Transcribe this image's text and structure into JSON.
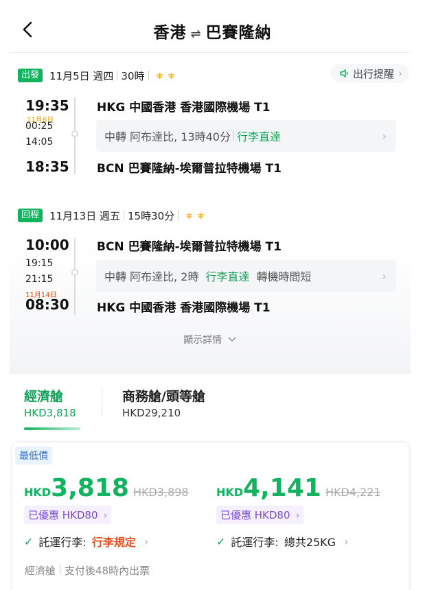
{
  "header": {
    "origin": "香港",
    "destination": "巴賽隆納",
    "swap_glyph": "⇌"
  },
  "outbound": {
    "tag": "出發",
    "date": "11月5日 週四",
    "duration": "30時",
    "reminder_label": "出行提醒",
    "depart_time": "19:35",
    "transfer_arrive_note": "11月6日",
    "transfer_arrive_time": "00:25",
    "transfer_depart_time": "14:05",
    "arrive_time": "18:35",
    "depart_airport": "HKG 中國香港 香港國際機場 T1",
    "transfer_text": "中轉 阿布達比, 13時40分",
    "transfer_baggage": "行李直達",
    "arrive_airport": "BCN 巴賽隆納-埃爾普拉特機場 T1"
  },
  "return": {
    "tag": "回程",
    "date": "11月13日 週五",
    "duration": "15時30分",
    "depart_time": "10:00",
    "transfer_arrive_time": "19:15",
    "transfer_depart_time": "21:15",
    "arrive_note": "11月14日",
    "arrive_time": "08:30",
    "depart_airport": "BCN 巴賽隆納-埃爾普拉特機場 T1",
    "transfer_text": "中轉 阿布達比, 2時",
    "transfer_baggage": "行李直達",
    "transfer_extra": "轉機時間短",
    "arrive_airport": "HKG 中國香港 香港國際機場 T1"
  },
  "details_toggle": "顯示詳情",
  "cabins": [
    {
      "name": "經濟艙",
      "price": "HKD3,818"
    },
    {
      "name": "商務艙/頭等艙",
      "price": "HKD29,210"
    }
  ],
  "offers": {
    "badge": "最低價",
    "left": {
      "currency": "HKD",
      "amount": "3,818",
      "original": "HKD3,898",
      "discount": "已優惠 HKD80",
      "baggage_label": "託運行李:",
      "baggage_value": "行李規定"
    },
    "right": {
      "currency": "HKD",
      "amount": "4,141",
      "original": "HKD4,221",
      "discount": "已優惠 HKD80",
      "baggage_label": "託運行李:",
      "baggage_value": "總共25KG"
    },
    "footer_cabin": "經濟艙",
    "footer_note": "支付後48時內出票"
  },
  "colors": {
    "brand_green": "#12b35f",
    "discount_purple": "#7b4bd6",
    "alert_orange": "#f04d1d",
    "badge_blue": "#2f6fcf"
  }
}
